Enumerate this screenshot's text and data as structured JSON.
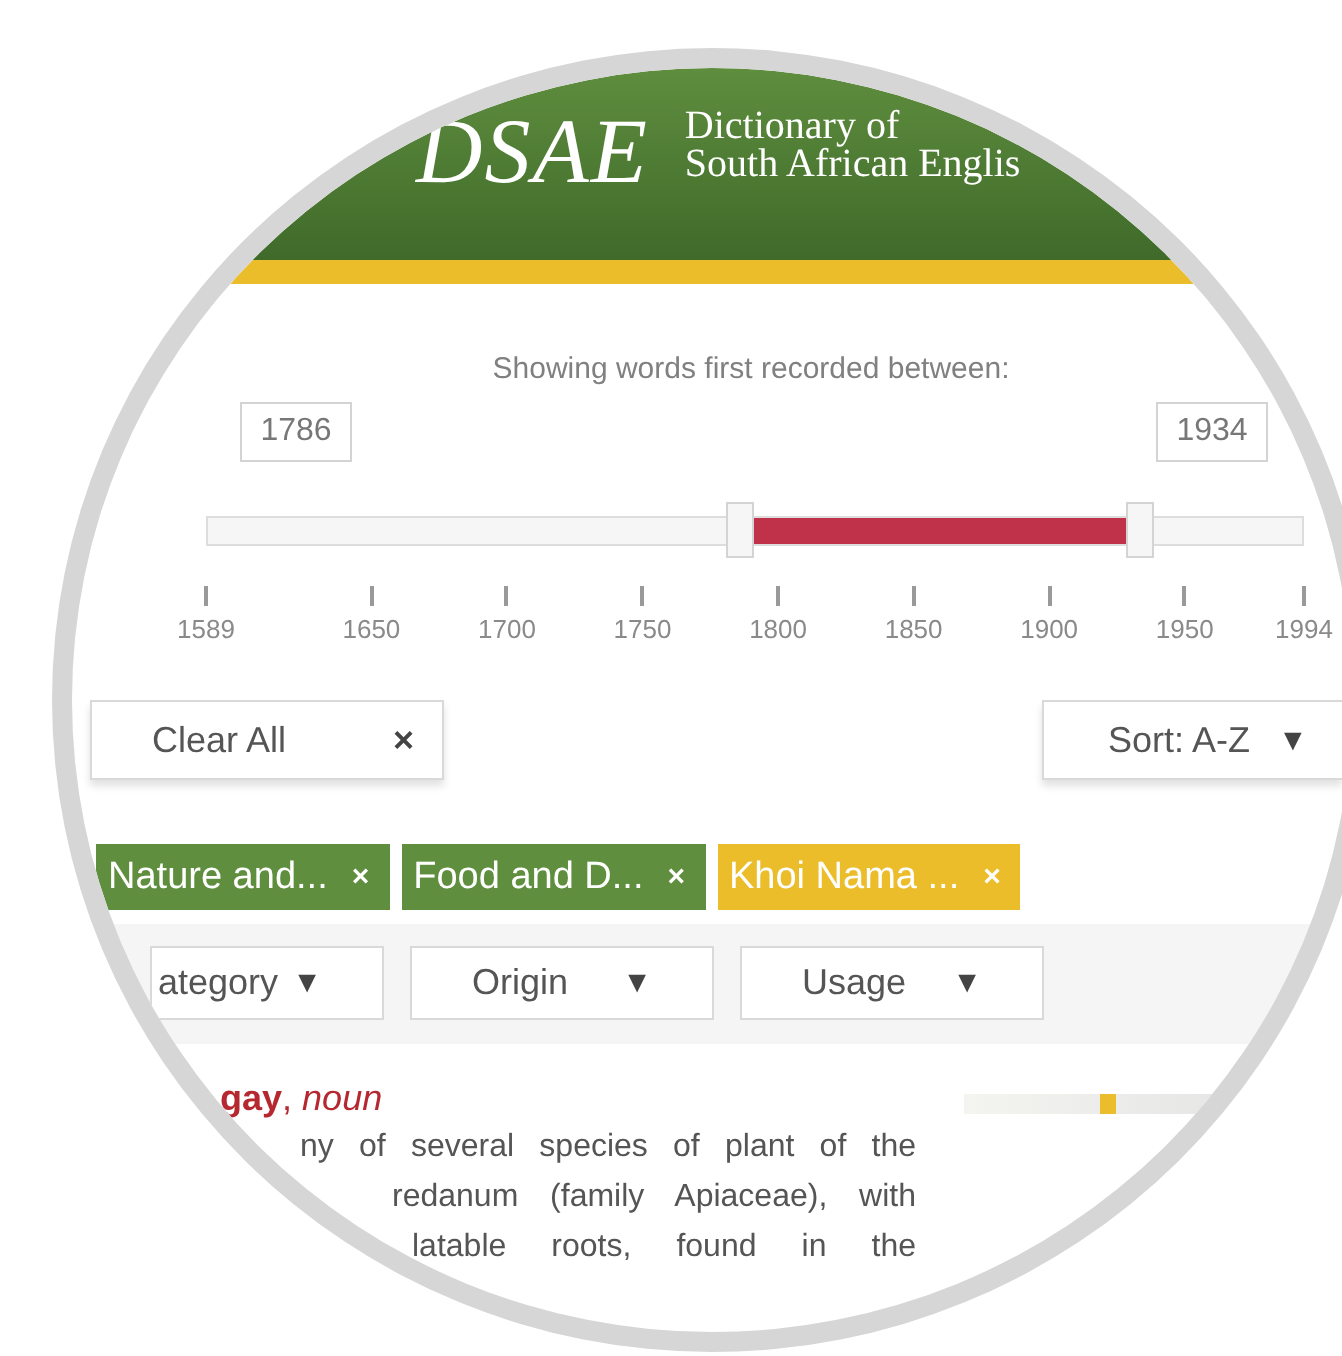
{
  "header": {
    "logo": "DSAE",
    "title_lines": [
      "Dictionary of",
      "South African Englis"
    ]
  },
  "date_filter": {
    "caption": "Showing words first recorded between:",
    "from": "1786",
    "to": "1934",
    "handles": [
      {
        "level": 0.486
      },
      {
        "level": 0.852
      }
    ],
    "ticks": [
      "1589",
      "1650",
      "1700",
      "1750",
      "1800",
      "1850",
      "1900",
      "1950",
      "1994"
    ]
  },
  "clear_button": {
    "label": "Clear All",
    "icon": "×"
  },
  "sort_button": {
    "label": "Sort: A-Z",
    "icon": "▼"
  },
  "tags": [
    {
      "label": "Nature and...",
      "remove": "×",
      "color": "#5f8f3e"
    },
    {
      "label": "Food and D...",
      "remove": "×",
      "color": "#5f8f3e"
    },
    {
      "label": "Khoi Nama ...",
      "remove": "×",
      "color": "#ebbd2a"
    }
  ],
  "filters": [
    {
      "label": "ategory",
      "icon": "▼"
    },
    {
      "label": "Origin",
      "icon": "▼"
    },
    {
      "label": "Usage",
      "icon": "▼"
    }
  ],
  "entry": {
    "heading": "**gay**, *noun*",
    "definition_lines": [
      "ny of several species of plant of the",
      "redanum (family Apiaceae), with",
      "latable roots, found in the"
    ]
  }
}
